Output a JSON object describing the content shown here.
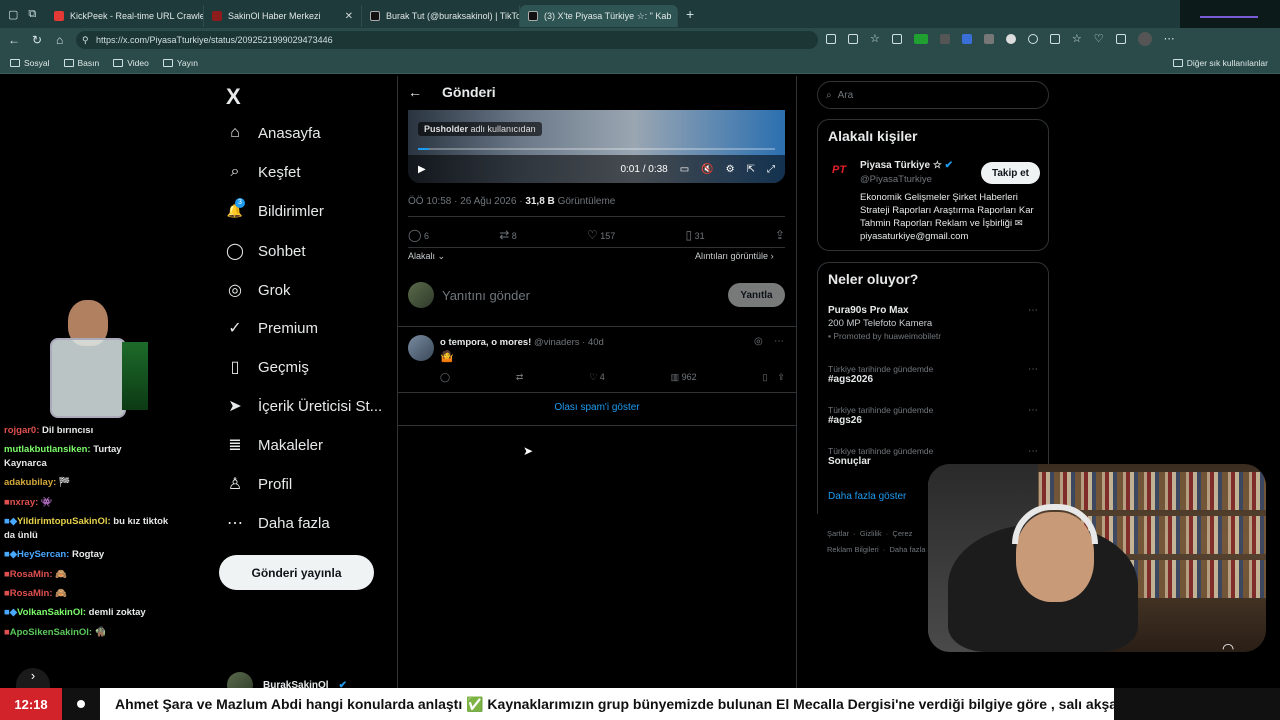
{
  "browser": {
    "tabs": [
      {
        "title": "KickPeek - Real-time URL Crawler",
        "color": "#e53935"
      },
      {
        "title": "SakinOl Haber Merkezi",
        "color": "#8d1d1d"
      },
      {
        "title": "Burak Tut (@buraksakinol) | TikTok",
        "color": "#111111"
      },
      {
        "title": "(3) X'te Piyasa Türkiye ☆: \" Kab",
        "color": "#111111"
      }
    ],
    "url": "https://x.com/PiyasaTturkiye/status/2092521999029473446",
    "bookmarks": [
      "Sosyal",
      "Basın",
      "Video",
      "Yayın"
    ],
    "other_bookmarks": "Diğer sık kullanılanlar"
  },
  "nav": {
    "logo": "X",
    "items": [
      {
        "label": "Anasayfa",
        "icon": "⌂"
      },
      {
        "label": "Keşfet",
        "icon": "⌕"
      },
      {
        "label": "Bildirimler",
        "icon": "🔔"
      },
      {
        "label": "Sohbet",
        "icon": "◯"
      },
      {
        "label": "Grok",
        "icon": "◎"
      },
      {
        "label": "Premium",
        "icon": "✓"
      },
      {
        "label": "Geçmiş",
        "icon": "▯"
      },
      {
        "label": "İçerik Üreticisi St...",
        "icon": "➤"
      },
      {
        "label": "Makaleler",
        "icon": "≣"
      },
      {
        "label": "Profil",
        "icon": "♙"
      },
      {
        "label": "Daha fazla",
        "icon": "⋯"
      }
    ],
    "notif_badge": "3",
    "post_button": "Gönderi yayınla",
    "account_name": "BurakSakinOl"
  },
  "post": {
    "header": "Gönderi",
    "video_tag_name": "Pusholder",
    "video_tag_suffix": "adlı kullanıcıdan",
    "video_time": "0:01 / 0:38",
    "timestamp": "ÖÖ 10:58 · 26 Ağu 2026 ·",
    "views": "31,8 B",
    "views_label": "Görüntüleme",
    "replies": "6",
    "reposts": "8",
    "likes": "157",
    "bookmarks": "31",
    "filter": "Alakalı",
    "quotes_link": "Alıntıları görüntüle",
    "reply_placeholder": "Yanıtını gönder",
    "reply_button": "Yanıtla"
  },
  "comment": {
    "author": "o tempora, o mores!",
    "handle": "@vinaders · 40d",
    "text": "🤷",
    "likes": "4",
    "views": "962"
  },
  "spam_link": "Olası spam'i göster",
  "right": {
    "search_placeholder": "Ara",
    "related_title": "Alakalı kişiler",
    "person_name": "Piyasa Türkiye ☆",
    "person_handle": "@PiyasaTturkiye",
    "follow": "Takip et",
    "bio": "Ekonomik Gelişmeler Şirket Haberleri Strateji Raporları Araştırma Raporları Kar Tahmin Raporları Reklam ve İşbirliği ✉ piyasaturkiye@gmail.com",
    "trends_title": "Neler oluyor?",
    "ad_title": "Pura90s Pro Max",
    "ad_sub": "200 MP Telefoto Kamera",
    "ad_promo": "Promoted by huaweimobiletr",
    "trends": [
      {
        "context": "Türkiye tarihinde gündemde",
        "name": "#ags2026"
      },
      {
        "context": "Türkiye tarihinde gündemde",
        "name": "#ags26"
      },
      {
        "context": "Türkiye tarihinde gündemde",
        "name": "Sonuçlar"
      }
    ],
    "show_more": "Daha fazla göster",
    "footer1": "Şartlar  ·  Gizlilik  ·  Çerez",
    "footer2": "Reklam Bilgileri  ·  Daha fazla"
  },
  "chat": [
    {
      "user": "rojgar0:",
      "text": "Dil bırıncısı",
      "color": "#e05050"
    },
    {
      "user": "mutlakbutlansiken:",
      "text": "Turtay Kaynarca",
      "color": "#7cfc6a"
    },
    {
      "user": "adakubilay:",
      "text": "🏁",
      "color": "#d4a93a"
    },
    {
      "user": "nxray:",
      "text": "👾",
      "color": "#e05050"
    },
    {
      "user": "YildirimtopuSakinOl:",
      "text": "bu kız tiktok da ünlü",
      "color": "#e6d24a"
    },
    {
      "user": "HeySercan:",
      "text": "Rogtay",
      "color": "#4aa8ff"
    },
    {
      "user": "RosaMin:",
      "text": "🙈",
      "color": "#e05050"
    },
    {
      "user": "RosaMin:",
      "text": "🙈",
      "color": "#e05050"
    },
    {
      "user": "VolkanSakinOl:",
      "text": "demli zoktay",
      "color": "#7cfc6a"
    },
    {
      "user": "ApoSikenSakinOl:",
      "text": "🧌",
      "color": "#5ac85a"
    }
  ],
  "ticker": {
    "time": "12:18",
    "text": "Ahmet Şara ve Mazlum Abdi hangi konularda anlaştı ✅ Kaynaklarımızın grup bünyemizde bulunan El Mecalla Dergisi'ne verdiği bilgiye göre , salı akşamı M"
  }
}
